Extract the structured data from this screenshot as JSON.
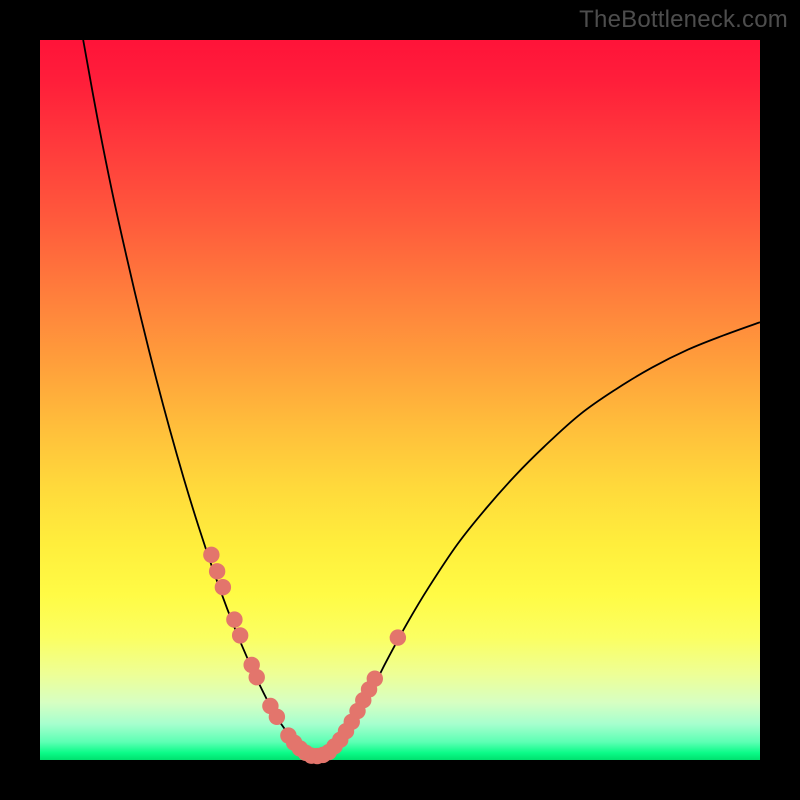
{
  "watermark": "TheBottleneck.com",
  "chart_data": {
    "type": "line",
    "title": "",
    "xlabel": "",
    "ylabel": "",
    "xlim": [
      0,
      100
    ],
    "ylim": [
      0,
      100
    ],
    "grid": false,
    "legend": false,
    "series": [
      {
        "name": "left-branch-curve",
        "x": [
          6,
          8,
          10,
          12,
          14,
          16,
          18,
          20,
          22,
          24,
          26,
          28,
          30,
          32,
          33.5,
          35,
          36.5,
          38
        ],
        "y": [
          100,
          89,
          79,
          70,
          61.5,
          53.5,
          46,
          39,
          32.5,
          26.5,
          21,
          16,
          11.5,
          7.5,
          5,
          3,
          1.5,
          0.5
        ]
      },
      {
        "name": "right-branch-curve",
        "x": [
          38,
          40,
          42,
          44,
          46,
          48,
          51,
          54,
          58,
          62,
          66,
          70,
          75,
          80,
          85,
          90,
          95,
          100
        ],
        "y": [
          0.5,
          1,
          3,
          6,
          9.5,
          13.5,
          19,
          24,
          30,
          35,
          39.5,
          43.5,
          48,
          51.5,
          54.5,
          57,
          59,
          60.8
        ]
      }
    ],
    "scatter": {
      "name": "highlighted-points",
      "points": [
        {
          "x": 23.8,
          "y": 28.5
        },
        {
          "x": 24.6,
          "y": 26.2
        },
        {
          "x": 25.4,
          "y": 24.0
        },
        {
          "x": 27.0,
          "y": 19.5
        },
        {
          "x": 27.8,
          "y": 17.3
        },
        {
          "x": 29.4,
          "y": 13.2
        },
        {
          "x": 30.1,
          "y": 11.5
        },
        {
          "x": 32.0,
          "y": 7.5
        },
        {
          "x": 32.9,
          "y": 6.0
        },
        {
          "x": 34.5,
          "y": 3.4
        },
        {
          "x": 35.3,
          "y": 2.4
        },
        {
          "x": 36.1,
          "y": 1.6
        },
        {
          "x": 36.9,
          "y": 1.0
        },
        {
          "x": 37.7,
          "y": 0.6
        },
        {
          "x": 38.5,
          "y": 0.55
        },
        {
          "x": 39.3,
          "y": 0.7
        },
        {
          "x": 40.1,
          "y": 1.1
        },
        {
          "x": 40.9,
          "y": 1.9
        },
        {
          "x": 41.7,
          "y": 2.8
        },
        {
          "x": 42.5,
          "y": 4.0
        },
        {
          "x": 43.3,
          "y": 5.3
        },
        {
          "x": 44.1,
          "y": 6.8
        },
        {
          "x": 44.9,
          "y": 8.3
        },
        {
          "x": 45.7,
          "y": 9.8
        },
        {
          "x": 46.5,
          "y": 11.3
        },
        {
          "x": 49.7,
          "y": 17.0
        }
      ]
    },
    "gradient_stops": [
      {
        "pos": 0.0,
        "color": "#ff1339"
      },
      {
        "pos": 0.15,
        "color": "#ff3b3c"
      },
      {
        "pos": 0.35,
        "color": "#ff8a3c"
      },
      {
        "pos": 0.55,
        "color": "#ffc83b"
      },
      {
        "pos": 0.75,
        "color": "#fffb45"
      },
      {
        "pos": 0.9,
        "color": "#d7ffc2"
      },
      {
        "pos": 1.0,
        "color": "#00e06e"
      }
    ]
  }
}
